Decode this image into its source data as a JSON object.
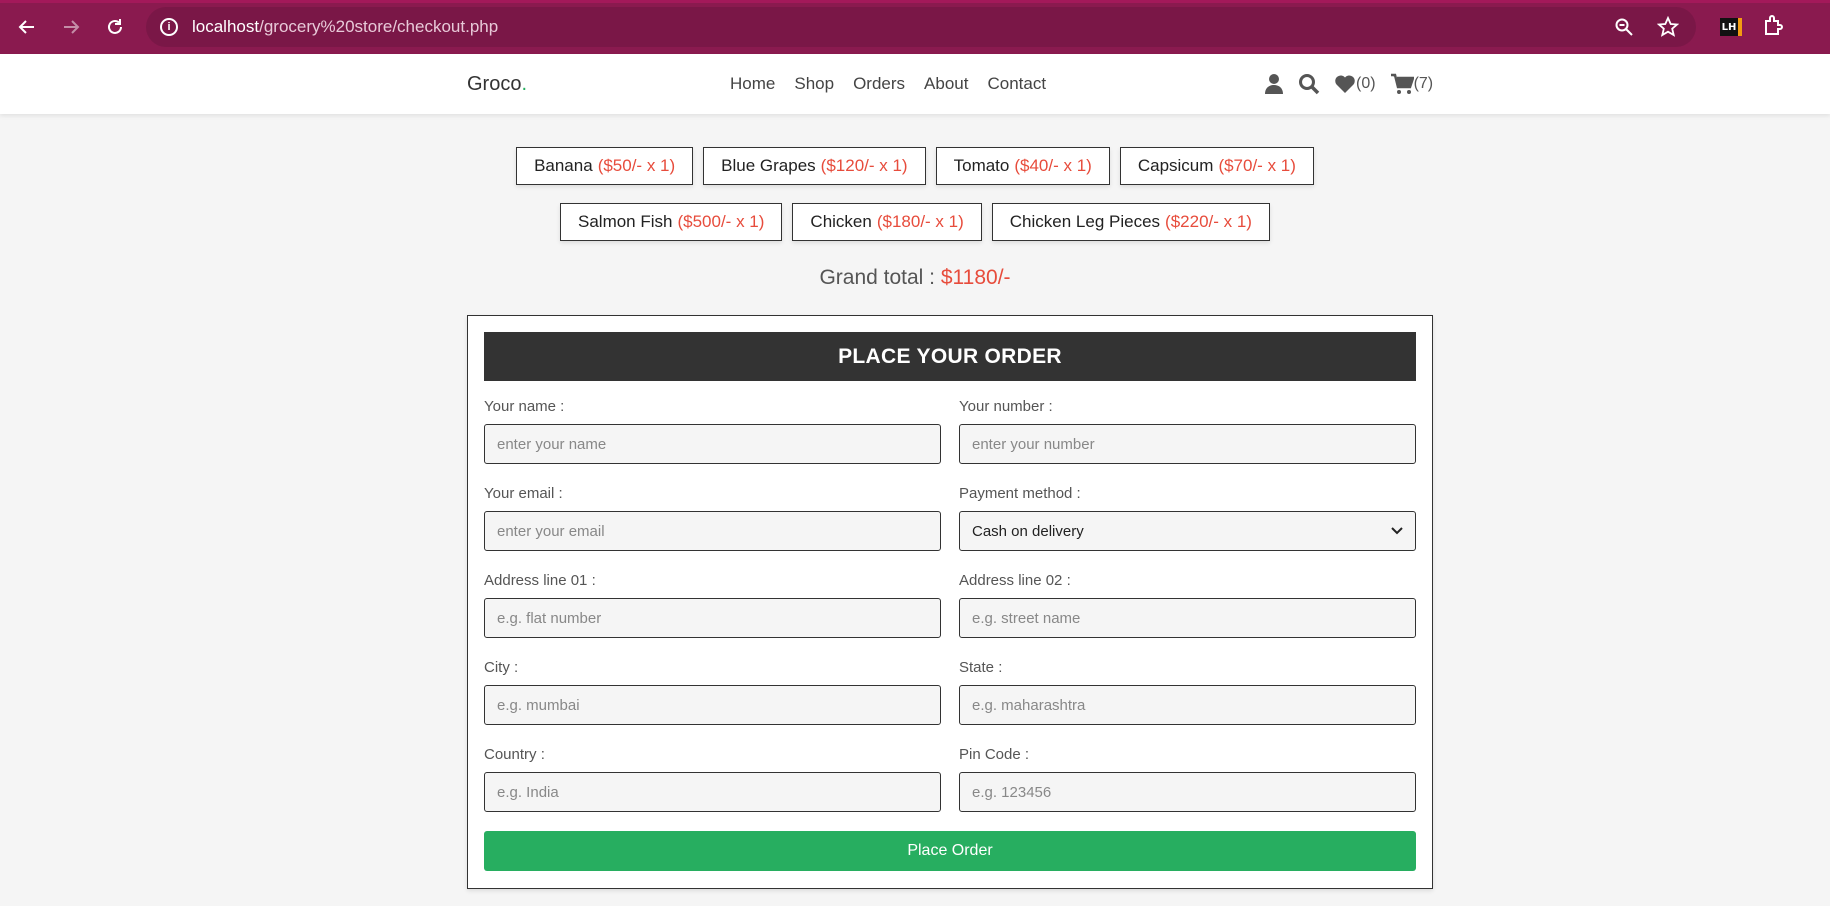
{
  "browser": {
    "url_host": "localhost",
    "url_path": "/grocery%20store/checkout.php",
    "lighthouse_label": "LH"
  },
  "header": {
    "logo_text": "Groco",
    "logo_dot": ".",
    "nav": [
      "Home",
      "Shop",
      "Orders",
      "About",
      "Contact"
    ],
    "wishlist_count": "(0)",
    "cart_count": "(7)"
  },
  "items_row1": [
    {
      "name": "Banana",
      "price": "($50/- x 1)"
    },
    {
      "name": "Blue Grapes",
      "price": "($120/- x 1)"
    },
    {
      "name": "Tomato",
      "price": "($40/- x 1)"
    },
    {
      "name": "Capsicum",
      "price": "($70/- x 1)"
    }
  ],
  "items_row2": [
    {
      "name": "Salmon Fish",
      "price": "($500/- x 1)"
    },
    {
      "name": "Chicken",
      "price": "($180/- x 1)"
    },
    {
      "name": "Chicken Leg Pieces",
      "price": "($220/- x 1)"
    }
  ],
  "grand_total": {
    "label": "Grand total :",
    "amount": "$1180/-"
  },
  "form": {
    "title": "PLACE YOUR ORDER",
    "fields": [
      {
        "label": "Your name :",
        "placeholder": "enter your name"
      },
      {
        "label": "Your number :",
        "placeholder": "enter your number"
      },
      {
        "label": "Your email :",
        "placeholder": "enter your email"
      },
      {
        "label": "Payment method :",
        "value": "Cash on delivery"
      },
      {
        "label": "Address line 01 :",
        "placeholder": "e.g. flat number"
      },
      {
        "label": "Address line 02 :",
        "placeholder": "e.g. street name"
      },
      {
        "label": "City :",
        "placeholder": "e.g. mumbai"
      },
      {
        "label": "State :",
        "placeholder": "e.g. maharashtra"
      },
      {
        "label": "Country :",
        "placeholder": "e.g. India"
      },
      {
        "label": "Pin Code :",
        "placeholder": "e.g. 123456"
      }
    ],
    "submit_label": "Place Order"
  },
  "colors": {
    "browser_bar": "#8a1a4f",
    "accent_green": "#27ae60",
    "price_red": "#e74c3c",
    "dark": "#333333"
  }
}
